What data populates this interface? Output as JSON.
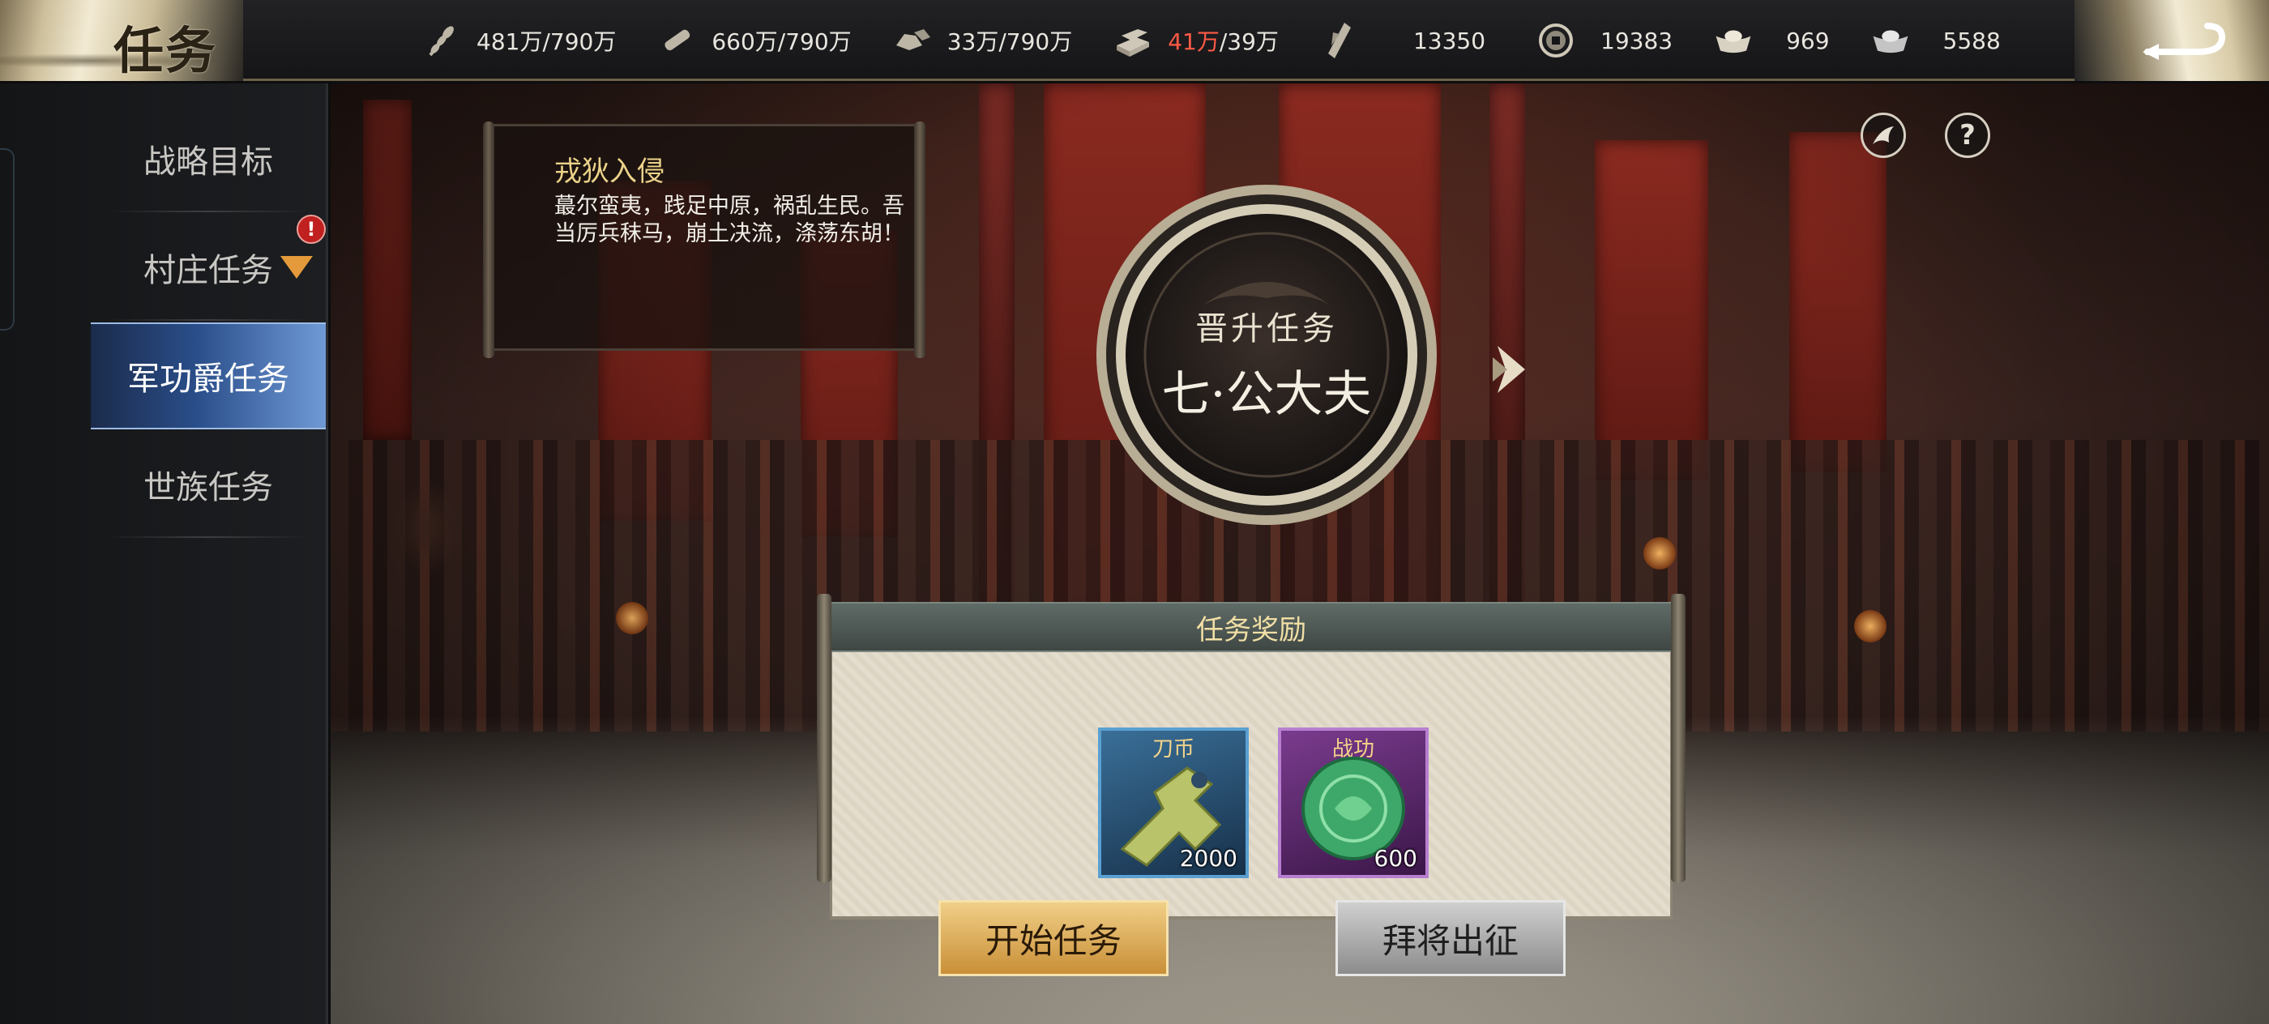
{
  "header": {
    "title": "任务",
    "back_icon": "return-arrow-icon",
    "resources": [
      {
        "icon": "grain-icon",
        "amount": "481万",
        "cap": "/790万",
        "highlight": false
      },
      {
        "icon": "wood-icon",
        "amount": "660万",
        "cap": "/790万",
        "highlight": false
      },
      {
        "icon": "stone-icon",
        "amount": "33万",
        "cap": "/790万",
        "highlight": false
      },
      {
        "icon": "iron-icon",
        "amount": "41万",
        "cap": "/39万",
        "highlight": true
      },
      {
        "icon": "order-icon",
        "amount": "13350",
        "cap": "",
        "highlight": false
      },
      {
        "icon": "copper-coin-icon",
        "amount": "19383",
        "cap": "",
        "highlight": false
      },
      {
        "icon": "gold-ingot-icon",
        "amount": "969",
        "cap": "",
        "highlight": false
      },
      {
        "icon": "silver-ingot-icon",
        "amount": "5588",
        "cap": "",
        "highlight": false
      }
    ]
  },
  "sidebar": {
    "items": [
      {
        "label": "战略目标",
        "active": false
      },
      {
        "label": "村庄任务",
        "active": false,
        "alert": "!"
      },
      {
        "label": "军功爵任务",
        "active": true
      },
      {
        "label": "世族任务",
        "active": false
      }
    ]
  },
  "quest": {
    "scroll_title": "戎狄入侵",
    "scroll_desc": "蕞尔蛮夷，践足中原，祸乱生民。吾当厉兵秣马，崩土决流，涤荡东胡！",
    "medal_title": "晋升任务",
    "rank": "七·公大夫"
  },
  "top_icons": {
    "help": "?",
    "rank_icon": "rank-emblem-icon"
  },
  "reward": {
    "header": "任务奖励",
    "items": [
      {
        "name": "刀币",
        "count": "2000",
        "icon": "knife-coin-icon",
        "rarity_color": "#5aa0d2"
      },
      {
        "name": "战功",
        "count": "600",
        "icon": "jade-disc-icon",
        "rarity_color": "#b77fd0"
      }
    ]
  },
  "buttons": {
    "start": "开始任务",
    "dispatch": "拜将出征"
  },
  "colors": {
    "accent_gold": "#f0cf87",
    "sidebar_active": "#2a4e8a",
    "warning": "#ff5a45"
  }
}
